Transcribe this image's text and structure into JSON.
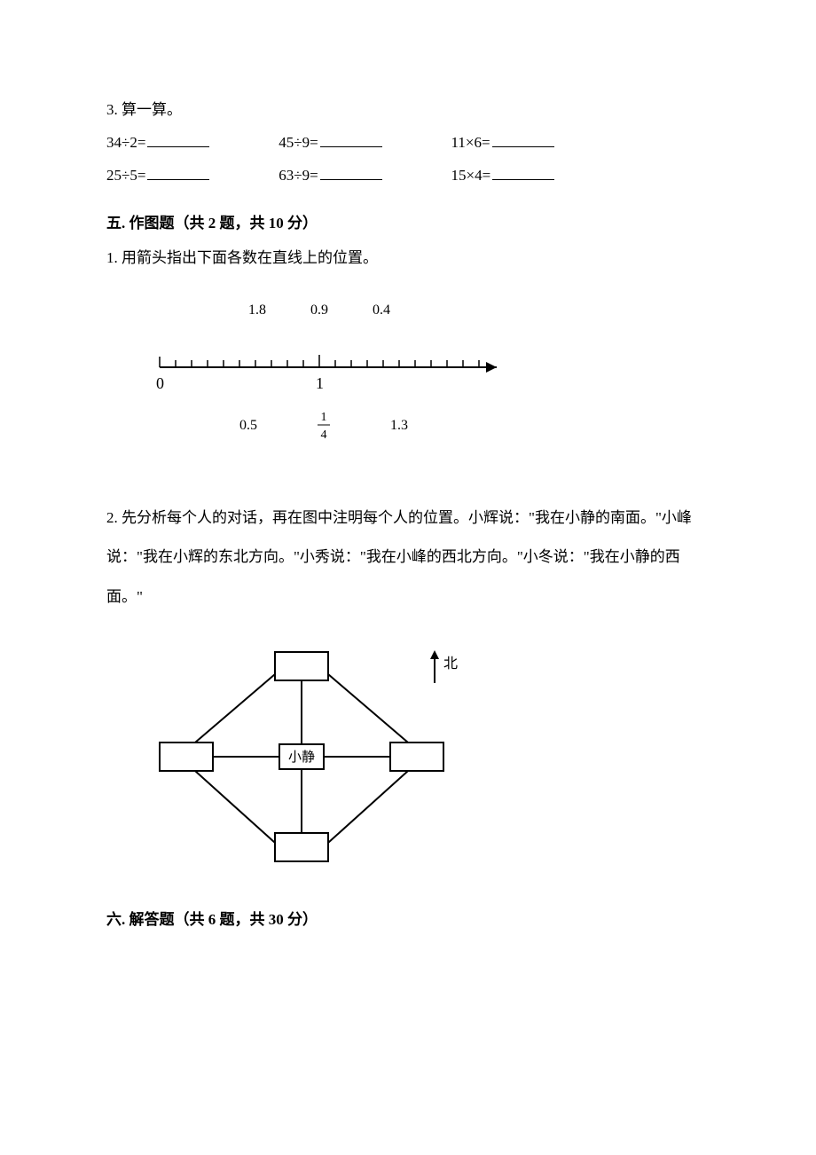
{
  "q3": {
    "prompt": "3. 算一算。",
    "row1": {
      "a": "34÷2=",
      "b": "45÷9=",
      "c": "11×6="
    },
    "row2": {
      "a": "25÷5=",
      "b": "63÷9=",
      "c": "15×4="
    }
  },
  "section5": {
    "heading": "五. 作图题（共 2 题，共 10 分）",
    "q1": {
      "prompt": "1. 用箭头指出下面各数在直线上的位置。",
      "labelsTop": {
        "a": "1.8",
        "b": "0.9",
        "c": "0.4"
      },
      "axis": {
        "label0": "0",
        "label1": "1"
      },
      "labelsBottom": {
        "a": "0.5",
        "bNum": "1",
        "bDen": "4",
        "c": "1.3"
      }
    },
    "q2": {
      "text": "2. 先分析每个人的对话，再在图中注明每个人的位置。小辉说：\"我在小静的南面。\"小峰说：\"我在小辉的东北方向。\"小秀说：\"我在小峰的西北方向。\"小冬说：\"我在小静的西面。\"",
      "north": "北",
      "center": "小静"
    }
  },
  "section6": {
    "heading": "六. 解答题（共 6 题，共 30 分）"
  }
}
